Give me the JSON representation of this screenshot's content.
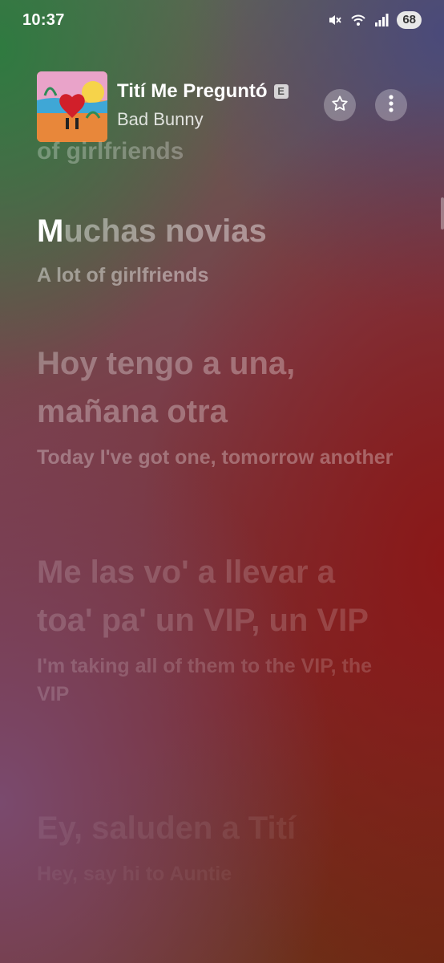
{
  "status_bar": {
    "time": "10:37",
    "battery": "68"
  },
  "now_playing": {
    "title": "Tití Me Preguntó",
    "explicit_badge": "E",
    "artist": "Bad Bunny"
  },
  "lyrics": {
    "previous_tail": "of girlfriends",
    "lines": [
      {
        "original_highlight": "M",
        "original_rest": "uchas novias",
        "translation": "A lot of girlfriends"
      },
      {
        "original": "Hoy tengo a una, mañana otra",
        "translation": "Today I've got one, tomorrow another"
      },
      {
        "original": "Me las vo' a llevar a toa' pa' un VIP, un VIP",
        "translation": "I'm taking all of them to the VIP, the VIP"
      },
      {
        "original": "Ey, saluden a Tití",
        "translation": "Hey, say hi to Auntie"
      }
    ]
  },
  "colors": {
    "text": "#ffffff",
    "accent_red": "#8a1818",
    "accent_green": "#2f7a40"
  },
  "icons": [
    "mute-icon",
    "wifi-icon",
    "signal-icon",
    "star-icon",
    "more-vertical-icon"
  ]
}
